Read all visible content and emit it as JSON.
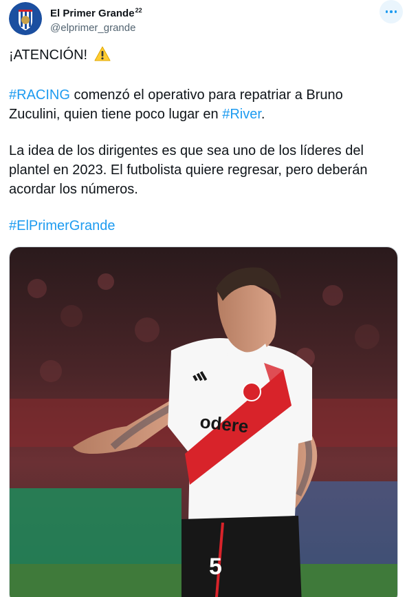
{
  "author": {
    "display_name": "El Primer Grande",
    "display_name_sup": "22",
    "handle": "@elprimer_grande",
    "avatar_icon": "club-crest-icon"
  },
  "more_icon": "more-horizontal-icon",
  "tweet": {
    "line1": "¡ATENCIÓN!",
    "line1_icon": "warning-icon",
    "hashtag_racing": "#RACING",
    "p2_text_a": " comenzó el operativo para repatriar a Bruno Zuculini, quien tiene poco lugar en ",
    "hashtag_river": "#River",
    "p2_text_b": ".",
    "p3": "La idea de los dirigentes es que sea uno de los líderes del plantel en 2023. El futbolista quiere regresar, pero deberán acordar los números.",
    "hashtag_final": "#ElPrimerGrande"
  },
  "media": {
    "jersey_sponsor": "odere",
    "jersey_number": "5"
  },
  "colors": {
    "link": "#1d9bf0",
    "text": "#0f1419",
    "secondary": "#536471",
    "jersey_red": "#d8232a"
  }
}
